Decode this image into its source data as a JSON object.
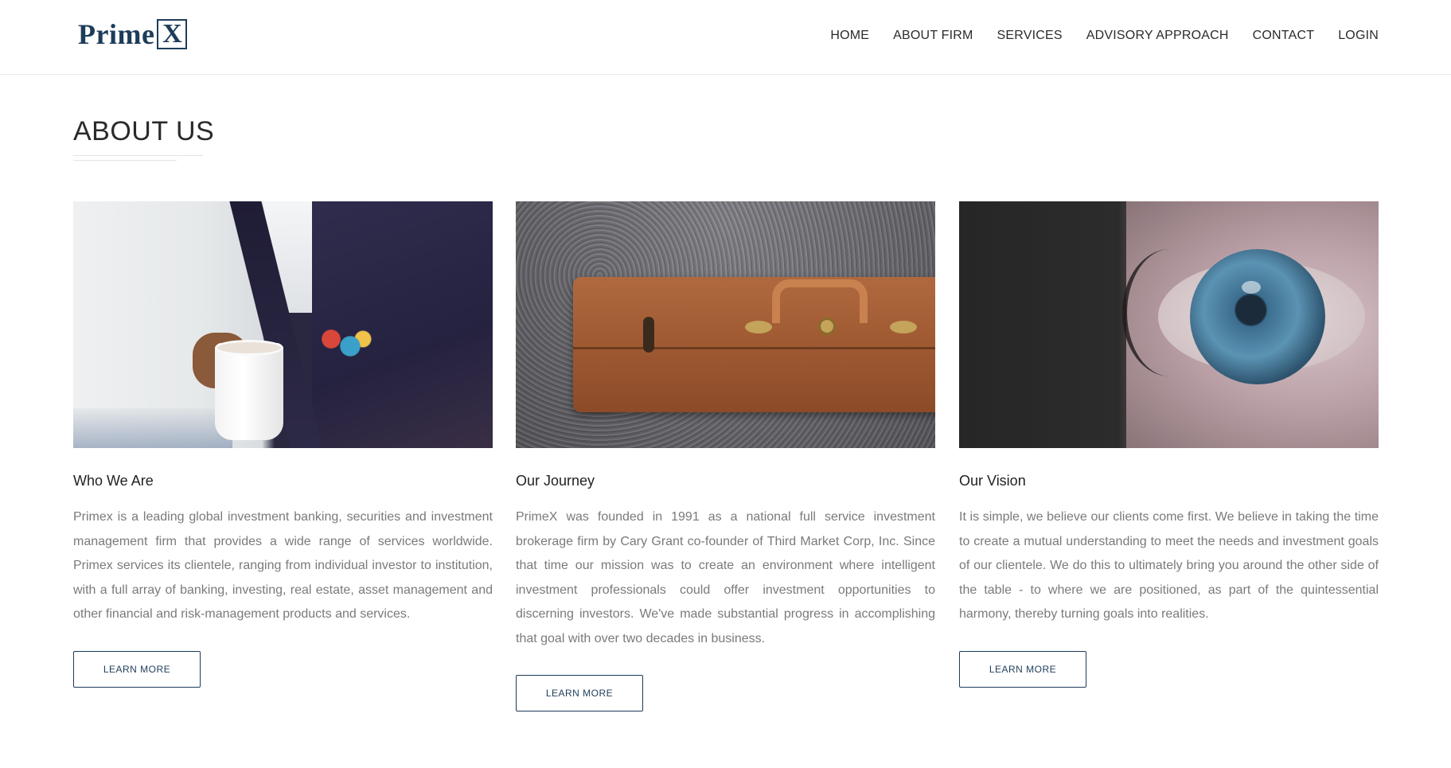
{
  "header": {
    "logo_text": "Prime",
    "logo_box_letter": "X",
    "nav": [
      "HOME",
      "ABOUT FIRM",
      "SERVICES",
      "ADVISORY APPROACH",
      "CONTACT",
      "LOGIN"
    ]
  },
  "section": {
    "title": "ABOUT US"
  },
  "columns": [
    {
      "heading": "Who We Are",
      "image": "suit-coffee-photo",
      "text": "Primex is a leading global investment banking, securities and investment management firm that provides a wide range of services worldwide. Primex services its clientele, ranging from individual investor to institution, with a full array of banking, investing, real estate, asset management and other financial and risk-management products and services.",
      "button": "LEARN MORE"
    },
    {
      "heading": "Our Journey",
      "image": "briefcase-photo",
      "text": "PrimeX was founded in 1991 as a national full service investment brokerage firm by Cary Grant co-founder of Third Market Corp, Inc. Since that time our mission was to create an environment where intelligent investment professionals could offer investment opportunities to discerning investors. We've made substantial progress in accomplishing that goal with over two decades in business.",
      "button": "LEARN MORE"
    },
    {
      "heading": "Our Vision",
      "image": "eye-photo",
      "text": "It is simple, we believe our clients come first. We believe in taking the time to create a mutual understanding to meet the needs and investment goals of our clientele. We do this to ultimately bring you around the other side of the table - to where we are positioned, as part of the quintessential harmony, thereby turning goals into realities.",
      "button": "LEARN MORE"
    }
  ],
  "colors": {
    "brand": "#1d3c5a",
    "body_text": "#7a7a7a",
    "heading_text": "#222222"
  }
}
